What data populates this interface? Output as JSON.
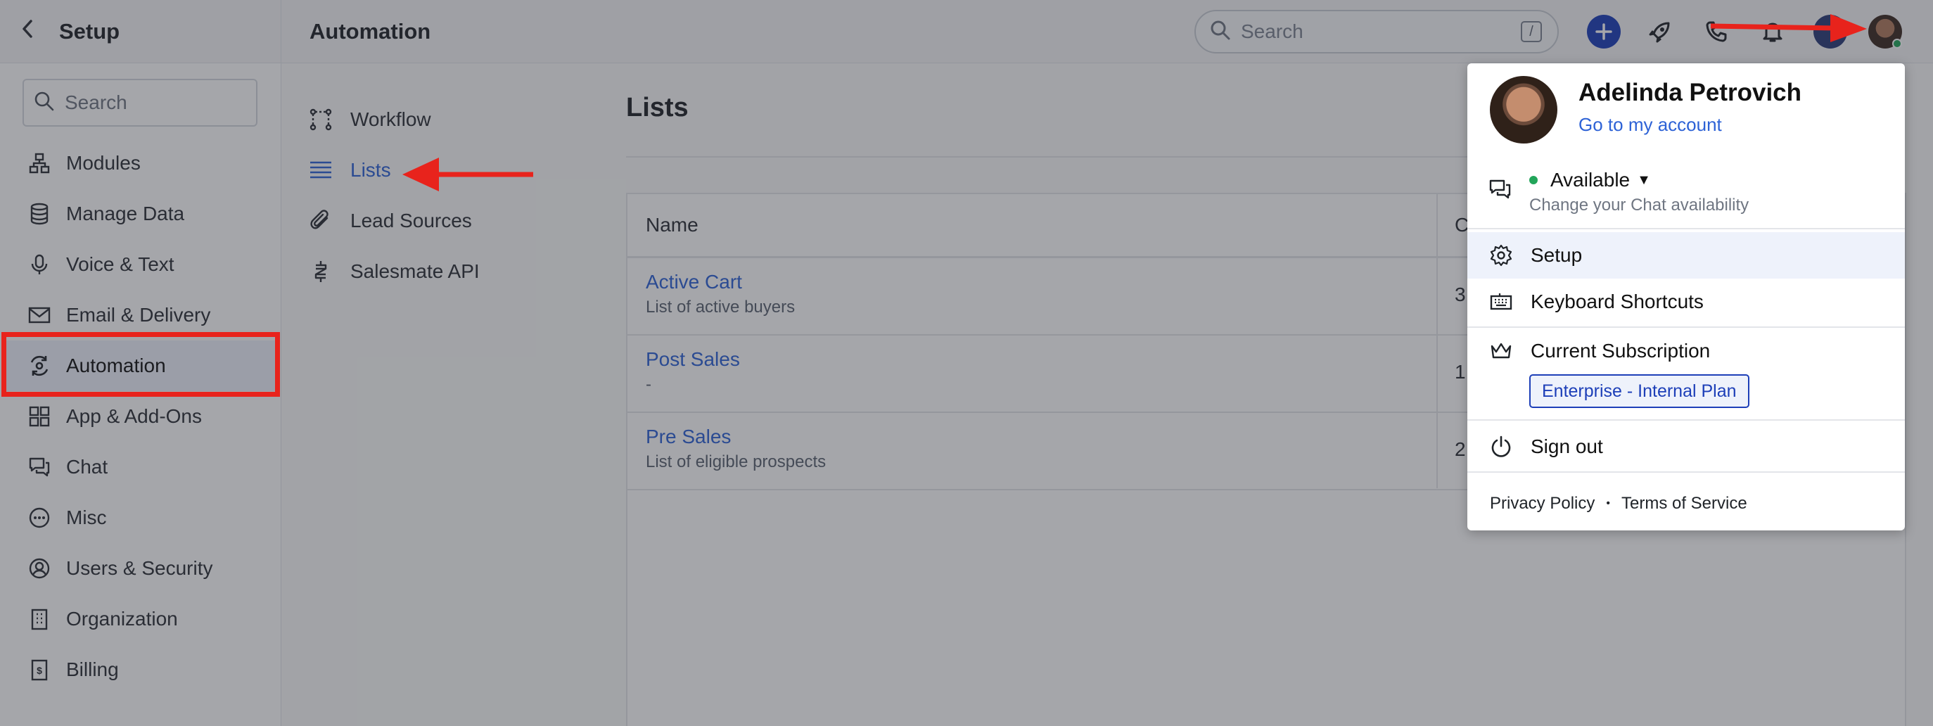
{
  "header": {
    "setup_title": "Setup",
    "page_title": "Automation",
    "search_placeholder": "Search",
    "search_shortcut": "/"
  },
  "sidebar": {
    "search_placeholder": "Search",
    "items": [
      {
        "label": "Modules",
        "icon": "modules-icon"
      },
      {
        "label": "Manage Data",
        "icon": "database-icon"
      },
      {
        "label": "Voice & Text",
        "icon": "microphone-icon"
      },
      {
        "label": "Email & Delivery",
        "icon": "envelope-icon"
      },
      {
        "label": "Automation",
        "icon": "automation-icon",
        "active": true
      },
      {
        "label": "App & Add-Ons",
        "icon": "grid-icon"
      },
      {
        "label": "Chat",
        "icon": "chat-icon"
      },
      {
        "label": "Misc",
        "icon": "more-icon"
      },
      {
        "label": "Users & Security",
        "icon": "user-circle-icon"
      },
      {
        "label": "Organization",
        "icon": "building-icon"
      },
      {
        "label": "Billing",
        "icon": "receipt-icon"
      }
    ]
  },
  "subnav": {
    "items": [
      {
        "label": "Workflow",
        "icon": "workflow-icon"
      },
      {
        "label": "Lists",
        "icon": "list-icon",
        "active": true
      },
      {
        "label": "Lead Sources",
        "icon": "paperclip-icon"
      },
      {
        "label": "Salesmate API",
        "icon": "api-icon"
      }
    ]
  },
  "main": {
    "title": "Lists",
    "columns": [
      "Name",
      "C"
    ],
    "rows": [
      {
        "name": "Active Cart",
        "description": "List of active buyers",
        "count": "3"
      },
      {
        "name": "Post Sales",
        "description": "-",
        "count": "1"
      },
      {
        "name": "Pre Sales",
        "description": "List of eligible prospects",
        "count": "2"
      }
    ]
  },
  "profile_menu": {
    "user_name": "Adelinda Petrovich",
    "account_link": "Go to my account",
    "status": "Available",
    "status_subtext": "Change your Chat availability",
    "setup_label": "Setup",
    "shortcuts_label": "Keyboard Shortcuts",
    "subscription_label": "Current Subscription",
    "plan": "Enterprise - Internal Plan",
    "signout_label": "Sign out",
    "privacy": "Privacy Policy",
    "separator": "•",
    "terms": "Terms of Service"
  },
  "colors": {
    "accent": "#2d62d6",
    "primary_button": "#1d3fb8",
    "annotation_red": "#e8231c",
    "online_green": "#22a55a"
  }
}
